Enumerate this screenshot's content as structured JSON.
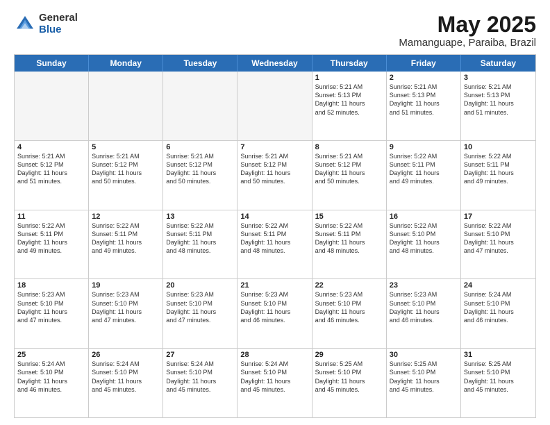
{
  "header": {
    "logo_general": "General",
    "logo_blue": "Blue",
    "title": "May 2025",
    "location": "Mamanguape, Paraiba, Brazil"
  },
  "days_of_week": [
    "Sunday",
    "Monday",
    "Tuesday",
    "Wednesday",
    "Thursday",
    "Friday",
    "Saturday"
  ],
  "weeks": [
    [
      {
        "day": "",
        "empty": true
      },
      {
        "day": "",
        "empty": true
      },
      {
        "day": "",
        "empty": true
      },
      {
        "day": "",
        "empty": true
      },
      {
        "day": "1",
        "lines": [
          "Sunrise: 5:21 AM",
          "Sunset: 5:13 PM",
          "Daylight: 11 hours",
          "and 52 minutes."
        ]
      },
      {
        "day": "2",
        "lines": [
          "Sunrise: 5:21 AM",
          "Sunset: 5:13 PM",
          "Daylight: 11 hours",
          "and 51 minutes."
        ]
      },
      {
        "day": "3",
        "lines": [
          "Sunrise: 5:21 AM",
          "Sunset: 5:13 PM",
          "Daylight: 11 hours",
          "and 51 minutes."
        ]
      }
    ],
    [
      {
        "day": "4",
        "lines": [
          "Sunrise: 5:21 AM",
          "Sunset: 5:12 PM",
          "Daylight: 11 hours",
          "and 51 minutes."
        ]
      },
      {
        "day": "5",
        "lines": [
          "Sunrise: 5:21 AM",
          "Sunset: 5:12 PM",
          "Daylight: 11 hours",
          "and 50 minutes."
        ]
      },
      {
        "day": "6",
        "lines": [
          "Sunrise: 5:21 AM",
          "Sunset: 5:12 PM",
          "Daylight: 11 hours",
          "and 50 minutes."
        ]
      },
      {
        "day": "7",
        "lines": [
          "Sunrise: 5:21 AM",
          "Sunset: 5:12 PM",
          "Daylight: 11 hours",
          "and 50 minutes."
        ]
      },
      {
        "day": "8",
        "lines": [
          "Sunrise: 5:21 AM",
          "Sunset: 5:12 PM",
          "Daylight: 11 hours",
          "and 50 minutes."
        ]
      },
      {
        "day": "9",
        "lines": [
          "Sunrise: 5:22 AM",
          "Sunset: 5:11 PM",
          "Daylight: 11 hours",
          "and 49 minutes."
        ]
      },
      {
        "day": "10",
        "lines": [
          "Sunrise: 5:22 AM",
          "Sunset: 5:11 PM",
          "Daylight: 11 hours",
          "and 49 minutes."
        ]
      }
    ],
    [
      {
        "day": "11",
        "lines": [
          "Sunrise: 5:22 AM",
          "Sunset: 5:11 PM",
          "Daylight: 11 hours",
          "and 49 minutes."
        ]
      },
      {
        "day": "12",
        "lines": [
          "Sunrise: 5:22 AM",
          "Sunset: 5:11 PM",
          "Daylight: 11 hours",
          "and 49 minutes."
        ]
      },
      {
        "day": "13",
        "lines": [
          "Sunrise: 5:22 AM",
          "Sunset: 5:11 PM",
          "Daylight: 11 hours",
          "and 48 minutes."
        ]
      },
      {
        "day": "14",
        "lines": [
          "Sunrise: 5:22 AM",
          "Sunset: 5:11 PM",
          "Daylight: 11 hours",
          "and 48 minutes."
        ]
      },
      {
        "day": "15",
        "lines": [
          "Sunrise: 5:22 AM",
          "Sunset: 5:11 PM",
          "Daylight: 11 hours",
          "and 48 minutes."
        ]
      },
      {
        "day": "16",
        "lines": [
          "Sunrise: 5:22 AM",
          "Sunset: 5:10 PM",
          "Daylight: 11 hours",
          "and 48 minutes."
        ]
      },
      {
        "day": "17",
        "lines": [
          "Sunrise: 5:22 AM",
          "Sunset: 5:10 PM",
          "Daylight: 11 hours",
          "and 47 minutes."
        ]
      }
    ],
    [
      {
        "day": "18",
        "lines": [
          "Sunrise: 5:23 AM",
          "Sunset: 5:10 PM",
          "Daylight: 11 hours",
          "and 47 minutes."
        ]
      },
      {
        "day": "19",
        "lines": [
          "Sunrise: 5:23 AM",
          "Sunset: 5:10 PM",
          "Daylight: 11 hours",
          "and 47 minutes."
        ]
      },
      {
        "day": "20",
        "lines": [
          "Sunrise: 5:23 AM",
          "Sunset: 5:10 PM",
          "Daylight: 11 hours",
          "and 47 minutes."
        ]
      },
      {
        "day": "21",
        "lines": [
          "Sunrise: 5:23 AM",
          "Sunset: 5:10 PM",
          "Daylight: 11 hours",
          "and 46 minutes."
        ]
      },
      {
        "day": "22",
        "lines": [
          "Sunrise: 5:23 AM",
          "Sunset: 5:10 PM",
          "Daylight: 11 hours",
          "and 46 minutes."
        ]
      },
      {
        "day": "23",
        "lines": [
          "Sunrise: 5:23 AM",
          "Sunset: 5:10 PM",
          "Daylight: 11 hours",
          "and 46 minutes."
        ]
      },
      {
        "day": "24",
        "lines": [
          "Sunrise: 5:24 AM",
          "Sunset: 5:10 PM",
          "Daylight: 11 hours",
          "and 46 minutes."
        ]
      }
    ],
    [
      {
        "day": "25",
        "lines": [
          "Sunrise: 5:24 AM",
          "Sunset: 5:10 PM",
          "Daylight: 11 hours",
          "and 46 minutes."
        ]
      },
      {
        "day": "26",
        "lines": [
          "Sunrise: 5:24 AM",
          "Sunset: 5:10 PM",
          "Daylight: 11 hours",
          "and 45 minutes."
        ]
      },
      {
        "day": "27",
        "lines": [
          "Sunrise: 5:24 AM",
          "Sunset: 5:10 PM",
          "Daylight: 11 hours",
          "and 45 minutes."
        ]
      },
      {
        "day": "28",
        "lines": [
          "Sunrise: 5:24 AM",
          "Sunset: 5:10 PM",
          "Daylight: 11 hours",
          "and 45 minutes."
        ]
      },
      {
        "day": "29",
        "lines": [
          "Sunrise: 5:25 AM",
          "Sunset: 5:10 PM",
          "Daylight: 11 hours",
          "and 45 minutes."
        ]
      },
      {
        "day": "30",
        "lines": [
          "Sunrise: 5:25 AM",
          "Sunset: 5:10 PM",
          "Daylight: 11 hours",
          "and 45 minutes."
        ]
      },
      {
        "day": "31",
        "lines": [
          "Sunrise: 5:25 AM",
          "Sunset: 5:10 PM",
          "Daylight: 11 hours",
          "and 45 minutes."
        ]
      }
    ]
  ]
}
